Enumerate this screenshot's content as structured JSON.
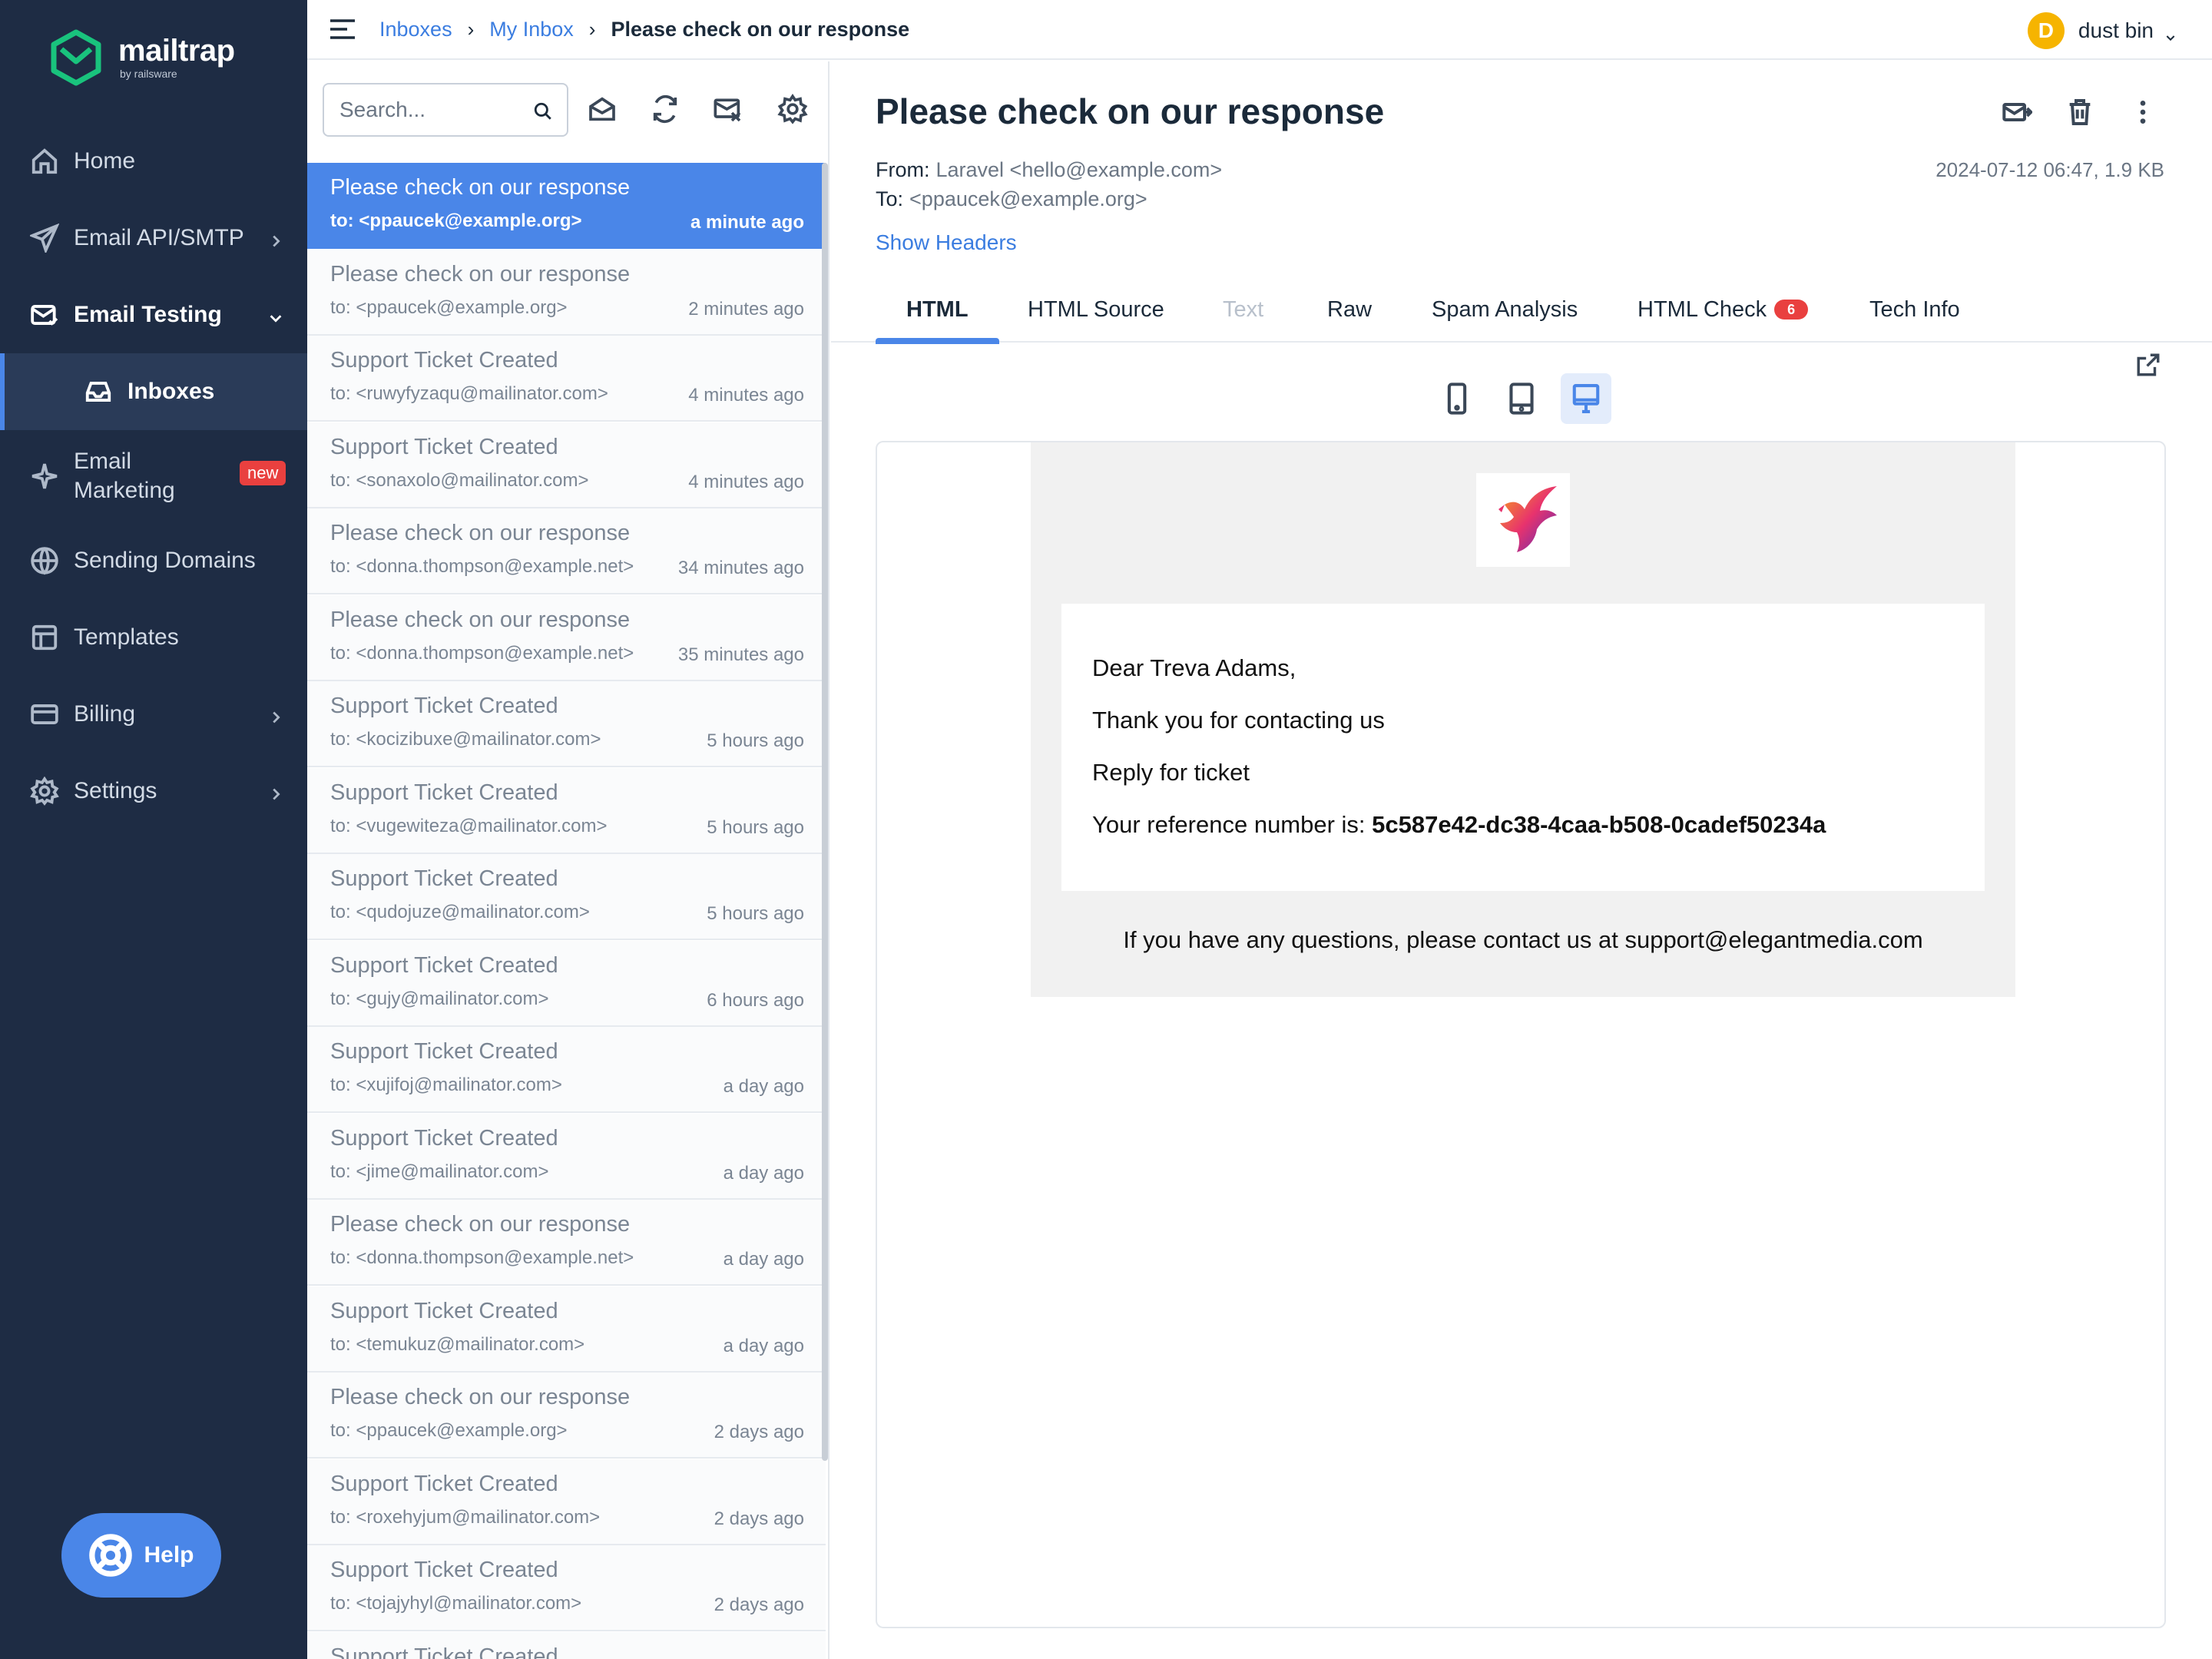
{
  "brand": {
    "name": "mailtrap",
    "sub": "by railsware"
  },
  "sidebar": {
    "items": [
      {
        "label": "Home"
      },
      {
        "label": "Email API/SMTP"
      },
      {
        "label": "Email Testing"
      },
      {
        "label": "Inboxes"
      },
      {
        "label": "Email",
        "label2": "Marketing",
        "badge": "new"
      },
      {
        "label": "Sending Domains"
      },
      {
        "label": "Templates"
      },
      {
        "label": "Billing"
      },
      {
        "label": "Settings"
      }
    ],
    "help": "Help"
  },
  "topbar": {
    "breadcrumb": [
      "Inboxes",
      "My Inbox",
      "Please check on our response"
    ],
    "separator": "›",
    "user": {
      "initial": "D",
      "name": "dust bin"
    }
  },
  "list": {
    "search_placeholder": "Search...",
    "messages": [
      {
        "subject": "Please check on our response",
        "to": "to: <ppaucek@example.org>",
        "time": "a minute ago"
      },
      {
        "subject": "Please check on our response",
        "to": "to: <ppaucek@example.org>",
        "time": "2 minutes ago"
      },
      {
        "subject": "Support Ticket Created",
        "to": "to: <ruwyfyzaqu@mailinator.com>",
        "time": "4 minutes ago"
      },
      {
        "subject": "Support Ticket Created",
        "to": "to: <sonaxolo@mailinator.com>",
        "time": "4 minutes ago"
      },
      {
        "subject": "Please check on our response",
        "to": "to: <donna.thompson@example.net>",
        "time": "34 minutes ago"
      },
      {
        "subject": "Please check on our response",
        "to": "to: <donna.thompson@example.net>",
        "time": "35 minutes ago"
      },
      {
        "subject": "Support Ticket Created",
        "to": "to: <kocizibuxe@mailinator.com>",
        "time": "5 hours ago"
      },
      {
        "subject": "Support Ticket Created",
        "to": "to: <vugewiteza@mailinator.com>",
        "time": "5 hours ago"
      },
      {
        "subject": "Support Ticket Created",
        "to": "to: <qudojuze@mailinator.com>",
        "time": "5 hours ago"
      },
      {
        "subject": "Support Ticket Created",
        "to": "to: <gujy@mailinator.com>",
        "time": "6 hours ago"
      },
      {
        "subject": "Support Ticket Created",
        "to": "to: <xujifoj@mailinator.com>",
        "time": "a day ago"
      },
      {
        "subject": "Support Ticket Created",
        "to": "to: <jime@mailinator.com>",
        "time": "a day ago"
      },
      {
        "subject": "Please check on our response",
        "to": "to: <donna.thompson@example.net>",
        "time": "a day ago"
      },
      {
        "subject": "Support Ticket Created",
        "to": "to: <temukuz@mailinator.com>",
        "time": "a day ago"
      },
      {
        "subject": "Please check on our response",
        "to": "to: <ppaucek@example.org>",
        "time": "2 days ago"
      },
      {
        "subject": "Support Ticket Created",
        "to": "to: <roxehyjum@mailinator.com>",
        "time": "2 days ago"
      },
      {
        "subject": "Support Ticket Created",
        "to": "to: <tojajyhyl@mailinator.com>",
        "time": "2 days ago"
      },
      {
        "subject": "Support Ticket Created",
        "to": "",
        "time": ""
      }
    ]
  },
  "detail": {
    "title": "Please check on our response",
    "from_label": "From:",
    "from_value": "Laravel <hello@example.com>",
    "to_label": "To:",
    "to_value": "<ppaucek@example.org>",
    "meta": "2024-07-12 06:47, 1.9 KB",
    "show_headers": "Show Headers",
    "tabs": [
      {
        "label": "HTML"
      },
      {
        "label": "HTML Source"
      },
      {
        "label": "Text"
      },
      {
        "label": "Raw"
      },
      {
        "label": "Spam Analysis"
      },
      {
        "label": "HTML Check",
        "count": "6"
      },
      {
        "label": "Tech Info"
      }
    ]
  },
  "email": {
    "greeting": "Dear Treva Adams,",
    "line1": "Thank you for contacting us",
    "line2": "Reply for ticket",
    "ref_label": "Your reference number is:",
    "ref_value": "5c587e42-dc38-4caa-b508-0cadef50234a",
    "footer": "If you have any questions, please contact us at support@elegantmedia.com"
  },
  "colors": {
    "sidebar": "#1e2c44",
    "accent": "#4a86e8",
    "badge": "#e9403f",
    "avatar": "#f6b400"
  }
}
